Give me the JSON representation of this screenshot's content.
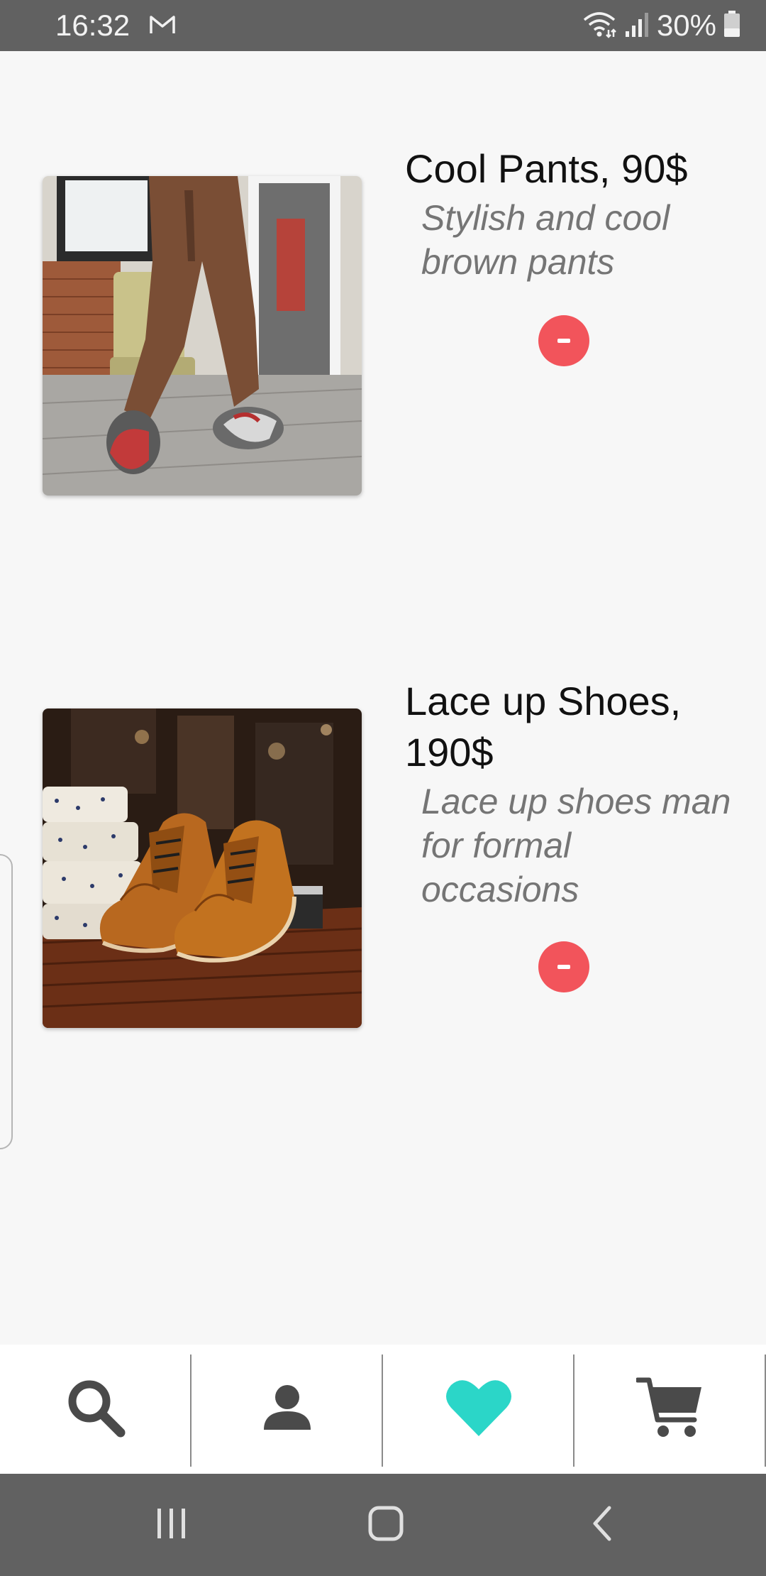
{
  "status_bar": {
    "time": "16:32",
    "battery": "30%",
    "icons": [
      "gmail-icon",
      "wifi-icon",
      "signal-icon",
      "battery-icon"
    ]
  },
  "favorites": [
    {
      "title": "Cool Pants, 90$",
      "description": "Stylish and cool brown pants",
      "image": "pants-photo",
      "action_icon": "minus-icon"
    },
    {
      "title": "Lace up Shoes, 190$",
      "description": "Lace up shoes man for formal occasions",
      "image": "shoes-photo",
      "action_icon": "minus-icon"
    }
  ],
  "tab_bar": {
    "tabs": [
      {
        "icon": "search-icon",
        "active": false
      },
      {
        "icon": "person-icon",
        "active": false
      },
      {
        "icon": "heart-icon",
        "active": true
      },
      {
        "icon": "cart-icon",
        "active": false
      }
    ],
    "active_color": "#2bd6c8",
    "inactive_color": "#4a4a4a"
  },
  "colors": {
    "remove_button": "#f2545b",
    "background": "#f7f7f7",
    "system_bar": "#616161"
  },
  "nav_bar": {
    "buttons": [
      "recent-apps-icon",
      "home-icon",
      "back-icon"
    ]
  }
}
